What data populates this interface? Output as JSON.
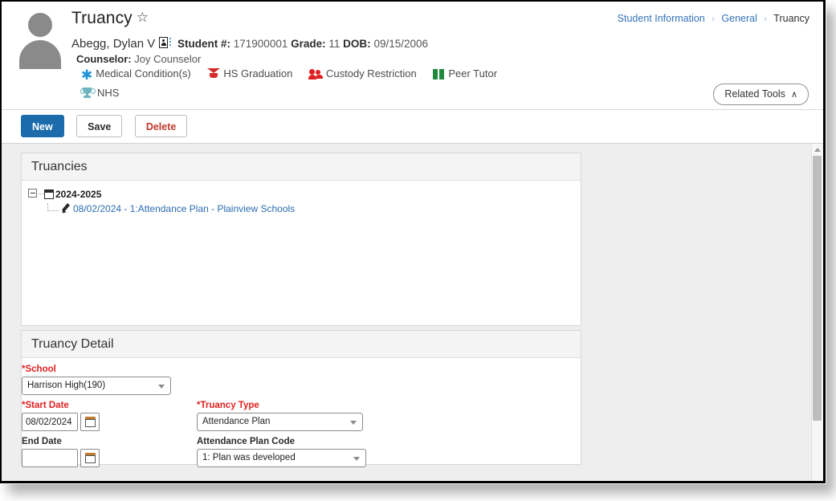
{
  "breadcrumb": {
    "items": [
      "Student Information",
      "General",
      "Truancy"
    ],
    "separator": "›"
  },
  "header": {
    "page_title": "Truancy",
    "favorite_icon": "☆",
    "student_name": "Abegg, Dylan V",
    "student_number_label": "Student #:",
    "student_number": "171900001",
    "grade_label": "Grade:",
    "grade": "11",
    "dob_label": "DOB:",
    "dob": "09/15/2006",
    "counselor_label": "Counselor:",
    "counselor": "Joy Counselor",
    "flags_row1": [
      {
        "label": "Medical Condition(s)",
        "icon": "asterisk-icon",
        "color": "#1e93d6"
      },
      {
        "label": "HS Graduation",
        "icon": "graduation-cap-icon",
        "color": "#d52b2b"
      },
      {
        "label": "Custody Restriction",
        "icon": "people-icon",
        "color": "#e02020"
      },
      {
        "label": "Peer Tutor",
        "icon": "book-icon",
        "color": "#1f8a3b"
      }
    ],
    "flags_row2": [
      {
        "label": "NHS",
        "icon": "trophy-icon",
        "color": "#6fb5c0"
      }
    ],
    "related_tools_label": "Related Tools",
    "related_tools_chevron": "∧"
  },
  "toolbar": {
    "new_label": "New",
    "save_label": "Save",
    "delete_label": "Delete"
  },
  "truancies_panel": {
    "title": "Truancies",
    "tree": {
      "year_label": "2024-2025",
      "children": [
        {
          "label": "08/02/2024 - 1:Attendance Plan - Plainview Schools"
        }
      ]
    }
  },
  "detail_panel": {
    "title": "Truancy Detail",
    "fields": {
      "school": {
        "label": "School",
        "required_marker": "*",
        "value": "Harrison High(190)"
      },
      "start_date": {
        "label": "Start Date",
        "required_marker": "*",
        "value": "08/02/2024"
      },
      "end_date": {
        "label": "End Date",
        "value": ""
      },
      "truancy_type": {
        "label": "Truancy Type",
        "required_marker": "*",
        "value": "Attendance Plan"
      },
      "attendance_plan_code": {
        "label": "Attendance Plan Code",
        "value": "1: Plan was developed"
      }
    }
  }
}
